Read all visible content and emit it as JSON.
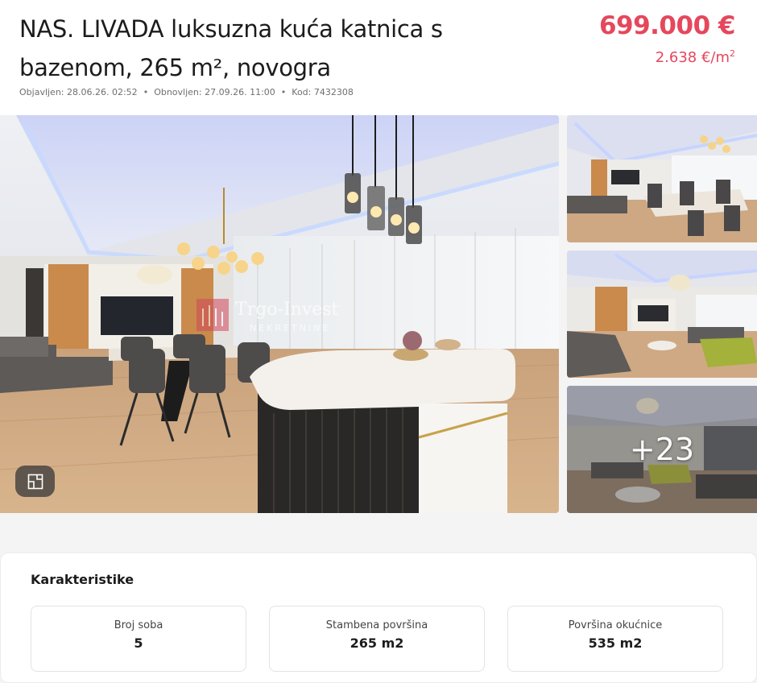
{
  "listing": {
    "title": "NAS. LIVADA luksuzna kuća katnica s bazenom, 265 m², novogra",
    "published": "Objavljen: 28.06.26. 02:52",
    "updated": "Obnovljen: 27.09.26. 11:00",
    "code": "Kod: 7432308",
    "price": "699.000 €",
    "price_per_m2": "2.638 €/m",
    "price_per_m2_sup": "2"
  },
  "gallery": {
    "watermark_name": "Trgo-Invest",
    "watermark_sub": "NEKRETNINE",
    "more_photos": "+23"
  },
  "features": {
    "title": "Karakteristike",
    "items": [
      {
        "label": "Broj soba",
        "value": "5"
      },
      {
        "label": "Stambena površina",
        "value": "265 m2"
      },
      {
        "label": "Površina okućnice",
        "value": "535 m2"
      }
    ]
  },
  "colors": {
    "accent": "#e5475c",
    "text": "#1c1c1c",
    "muted": "#6f6f6f"
  },
  "icons": [
    "floor-plan-icon",
    "watermark-logo-icon"
  ]
}
